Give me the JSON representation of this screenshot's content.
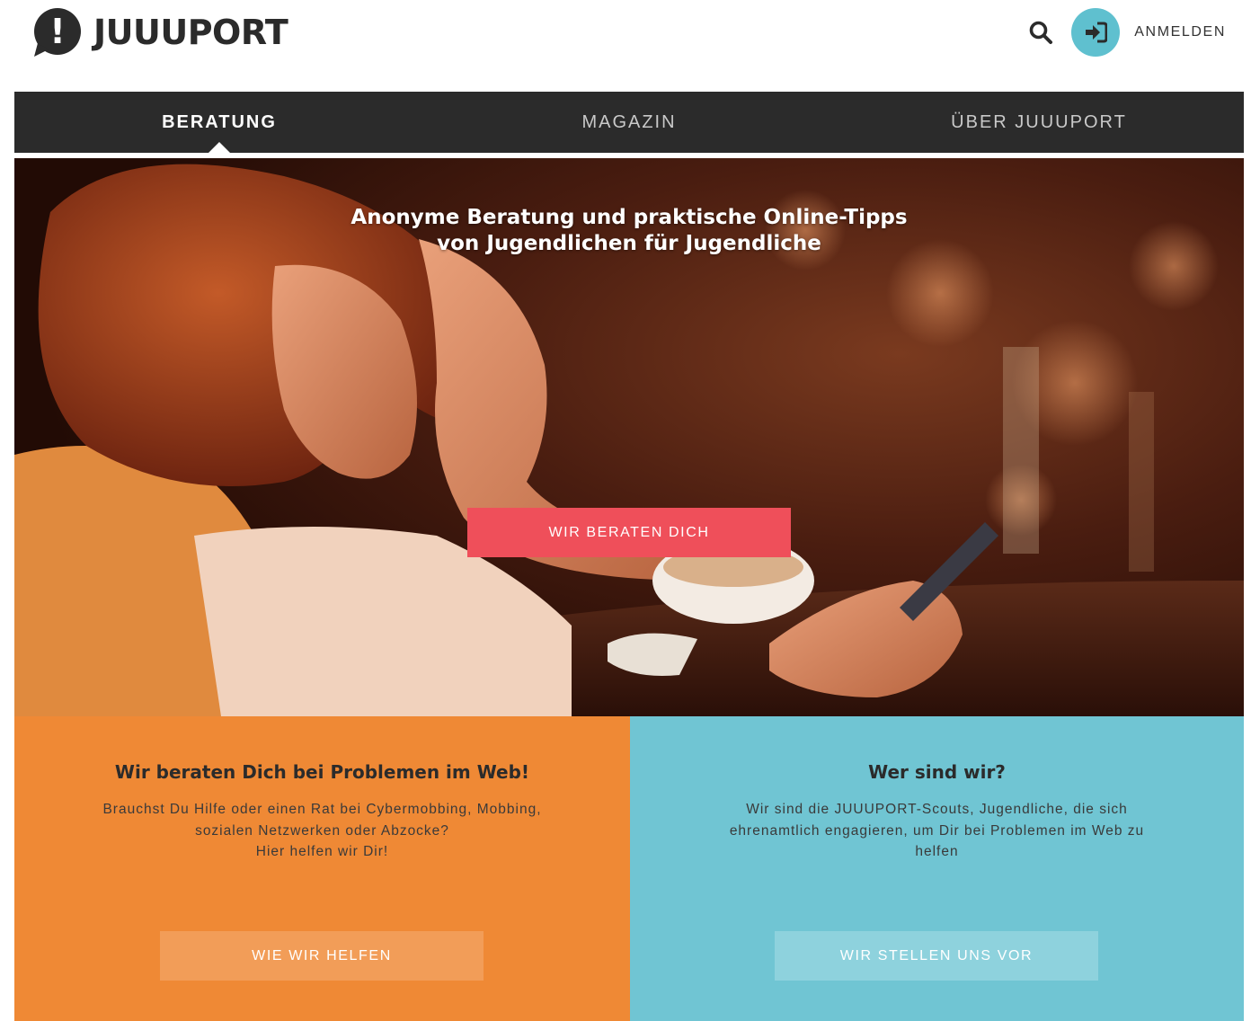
{
  "brand": {
    "name": "JUUUPORT",
    "mark_glyph": "!"
  },
  "header": {
    "login_label": "ANMELDEN",
    "accent": "#5fc0cf"
  },
  "nav": {
    "items": [
      {
        "label": "BERATUNG",
        "active": true
      },
      {
        "label": "MAGAZIN",
        "active": false
      },
      {
        "label": "ÜBER JUUUPORT",
        "active": false
      }
    ]
  },
  "hero": {
    "title_line1": "Anonyme Beratung und praktische Online-Tipps",
    "title_line2": "von Jugendlichen für Jugendliche",
    "cta_label": "WIR BERATEN DICH",
    "cta_color": "#ef4f5a"
  },
  "panels": {
    "left": {
      "title": "Wir beraten Dich bei Problemen im Web!",
      "text_line1": "Brauchst Du Hilfe oder einen Rat bei Cybermobbing, Mobbing,",
      "text_line2": "sozialen Netzwerken oder Abzocke?",
      "text_line3": "Hier helfen wir Dir!",
      "button_label": "WIE WIR HELFEN",
      "color": "#ef8935"
    },
    "right": {
      "title": "Wer sind wir?",
      "text_line1": "Wir sind die JUUUPORT-Scouts, Jugendliche, die sich",
      "text_line2": "ehrenamtlich engagieren, um Dir bei Problemen im Web zu",
      "text_line3": "helfen",
      "button_label": "WIR STELLEN UNS VOR",
      "color": "#70c5d3"
    }
  },
  "icons": {
    "search": "search-icon",
    "login": "sign-in-icon",
    "logo": "speech-bubble-exclamation-icon"
  }
}
